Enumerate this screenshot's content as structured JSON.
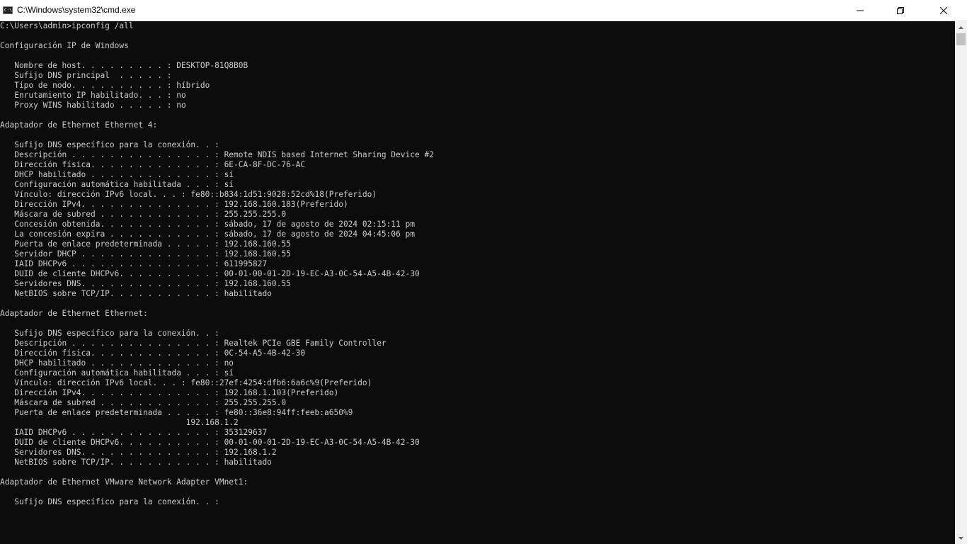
{
  "window": {
    "title": "C:\\Windows\\system32\\cmd.exe",
    "icon_label": "C:\\",
    "controls": {
      "minimize_icon": "minimize-icon",
      "maximize_icon": "maximize-icon",
      "close_icon": "close-icon"
    }
  },
  "colors": {
    "console_background": "#0c0c0c",
    "console_text": "#cccccc",
    "titlebar_background": "#ffffff",
    "scrollbar_track": "#f0f0f0",
    "scrollbar_thumb": "#c1c1c1"
  },
  "console": {
    "lines": [
      "C:\\Users\\admin>ipconfig /all",
      "",
      "Configuración IP de Windows",
      "",
      "   Nombre de host. . . . . . . . . : DESKTOP-81Q8B0B",
      "   Sufijo DNS principal  . . . . . :",
      "   Tipo de nodo. . . . . . . . . . : híbrido",
      "   Enrutamiento IP habilitado. . . : no",
      "   Proxy WINS habilitado . . . . . : no",
      "",
      "Adaptador de Ethernet Ethernet 4:",
      "",
      "   Sufijo DNS específico para la conexión. . :",
      "   Descripción . . . . . . . . . . . . . . . : Remote NDIS based Internet Sharing Device #2",
      "   Dirección física. . . . . . . . . . . . . : 6E-CA-8F-DC-76-AC",
      "   DHCP habilitado . . . . . . . . . . . . . : sí",
      "   Configuración automática habilitada . . . : sí",
      "   Vínculo: dirección IPv6 local. . . : fe80::b834:1d51:9028:52cd%18(Preferido)",
      "   Dirección IPv4. . . . . . . . . . . . . . : 192.168.160.183(Preferido)",
      "   Máscara de subred . . . . . . . . . . . . : 255.255.255.0",
      "   Concesión obtenida. . . . . . . . . . . . : sábado, 17 de agosto de 2024 02:15:11 pm",
      "   La concesión expira . . . . . . . . . . . : sábado, 17 de agosto de 2024 04:45:06 pm",
      "   Puerta de enlace predeterminada . . . . . : 192.168.160.55",
      "   Servidor DHCP . . . . . . . . . . . . . . : 192.168.160.55",
      "   IAID DHCPv6 . . . . . . . . . . . . . . . : 611995827",
      "   DUID de cliente DHCPv6. . . . . . . . . . : 00-01-00-01-2D-19-EC-A3-0C-54-A5-4B-42-30",
      "   Servidores DNS. . . . . . . . . . . . . . : 192.168.160.55",
      "   NetBIOS sobre TCP/IP. . . . . . . . . . . : habilitado",
      "",
      "Adaptador de Ethernet Ethernet:",
      "",
      "   Sufijo DNS específico para la conexión. . :",
      "   Descripción . . . . . . . . . . . . . . . : Realtek PCIe GBE Family Controller",
      "   Dirección física. . . . . . . . . . . . . : 0C-54-A5-4B-42-30",
      "   DHCP habilitado . . . . . . . . . . . . . : no",
      "   Configuración automática habilitada . . . : sí",
      "   Vínculo: dirección IPv6 local. . . : fe80::27ef:4254:dfb6:6a6c%9(Preferido)",
      "   Dirección IPv4. . . . . . . . . . . . . . : 192.168.1.103(Preferido)",
      "   Máscara de subred . . . . . . . . . . . . : 255.255.255.0",
      "   Puerta de enlace predeterminada . . . . . : fe80::36e8:94ff:feeb:a650%9",
      "                                       192.168.1.2",
      "   IAID DHCPv6 . . . . . . . . . . . . . . . : 353129637",
      "   DUID de cliente DHCPv6. . . . . . . . . . : 00-01-00-01-2D-19-EC-A3-0C-54-A5-4B-42-30",
      "   Servidores DNS. . . . . . . . . . . . . . : 192.168.1.2",
      "   NetBIOS sobre TCP/IP. . . . . . . . . . . : habilitado",
      "",
      "Adaptador de Ethernet VMware Network Adapter VMnet1:",
      "",
      "   Sufijo DNS específico para la conexión. . :"
    ]
  }
}
